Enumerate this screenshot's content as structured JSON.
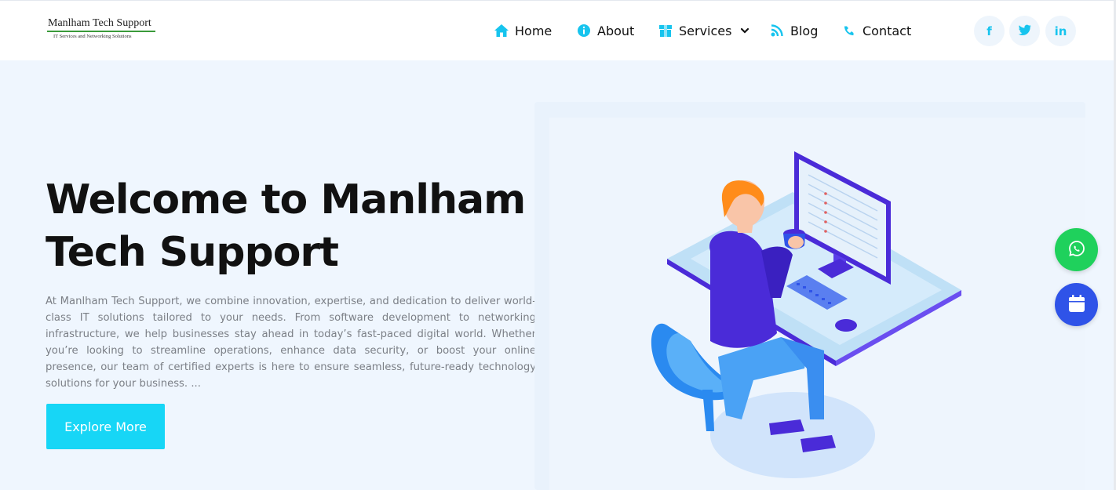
{
  "logo": {
    "title": "Manlham Tech Support",
    "subtitle": "IT Services and Networking Solutions"
  },
  "nav": {
    "items": [
      {
        "label": "Home",
        "icon": "home-icon"
      },
      {
        "label": "About",
        "icon": "info-icon"
      },
      {
        "label": "Services",
        "icon": "box-icon",
        "dropdown": true
      },
      {
        "label": "Blog",
        "icon": "rss-icon"
      },
      {
        "label": "Contact",
        "icon": "phone-icon"
      }
    ]
  },
  "social": {
    "facebook": "f",
    "twitter": "twitter-icon",
    "linkedin": "in"
  },
  "hero": {
    "title": "Welcome to Manlham Tech Support",
    "description": "At Manlham Tech Support, we combine innovation, expertise, and dedication to deliver world-class IT solutions tailored to your needs. From software development to networking infrastructure, we help businesses stay ahead in today’s fast-paced digital world. Whether you’re looking to streamline operations, enhance data security, or boost your online presence, our team of certified experts is here to ensure seamless, future-ready technology solutions for your business. ...",
    "button_label": "Explore More"
  },
  "floating": {
    "whatsapp_icon": "whatsapp-icon",
    "calendar_icon": "calendar-icon"
  },
  "colors": {
    "accent": "#17d6f6",
    "icon_accent": "#17c4ee",
    "whatsapp": "#1fd15c",
    "calendar": "#2f53e8",
    "hero_bg": "#eff6fe"
  }
}
